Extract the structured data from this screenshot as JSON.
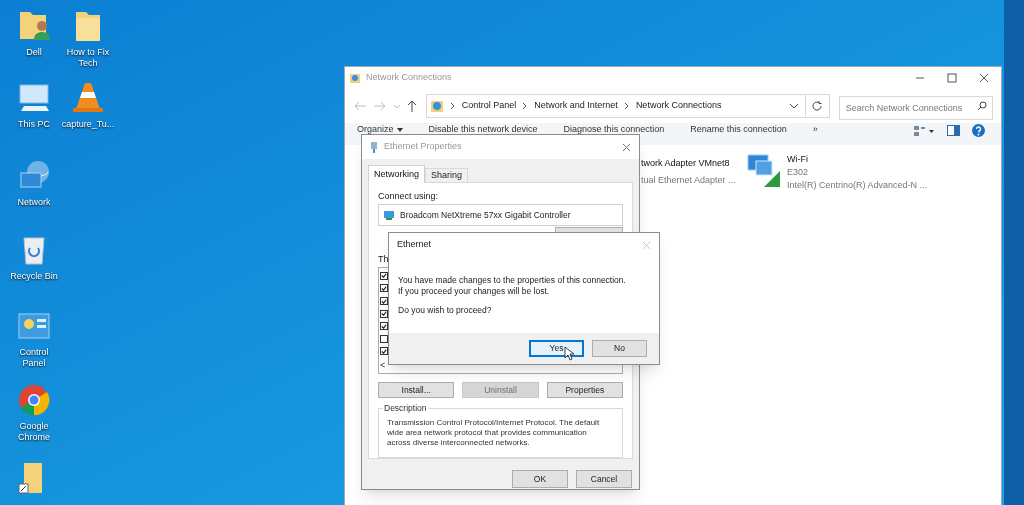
{
  "desktop_icons": [
    {
      "label": "Dell",
      "kind": "user-folder"
    },
    {
      "label": "How to Fix Tech",
      "kind": "folder"
    },
    {
      "label": "This PC",
      "kind": "pc"
    },
    {
      "label": "capture_Tu...",
      "kind": "cone"
    },
    {
      "label": "Network",
      "kind": "network"
    },
    {
      "label": "Recycle Bin",
      "kind": "bin"
    },
    {
      "label": "Control Panel",
      "kind": "panel"
    },
    {
      "label": "Google Chrome",
      "kind": "browser"
    },
    {
      "kind": "folder-shortcut"
    }
  ],
  "explorer": {
    "title": "Network Connections",
    "breadcrumb": [
      "Control Panel",
      "Network and Internet",
      "Network Connections"
    ],
    "search": {
      "placeholder": "Search Network Connections"
    },
    "toolbar": [
      "Organize",
      "Disable this network device",
      "Diagnose this connection",
      "Rename this connection",
      "»"
    ],
    "connections": [
      {
        "name": "twork Adapter VMnet8",
        "device": "tual Ethernet Adapter ...",
        "kind": "cut"
      },
      {
        "name": "Wi-Fi",
        "status": "E302",
        "device": "Intel(R) Centrino(R) Advanced-N ...",
        "kind": "wifi"
      }
    ]
  },
  "properties": {
    "title": "Ethernet Properties",
    "tabs": [
      {
        "label": "Networking",
        "selected": true
      },
      {
        "label": "Sharing",
        "selected": false
      }
    ],
    "connect_label": "Connect using:",
    "adapter": "Broadcom NetXtreme 57xx Gigabit Controller",
    "items_label": "Th",
    "items": [
      {
        "checked": true
      },
      {
        "checked": true
      },
      {
        "checked": true
      },
      {
        "checked": true
      },
      {
        "checked": true
      },
      {
        "checked": false
      },
      {
        "checked": true
      }
    ],
    "scroll_left": "<",
    "buttons": [
      {
        "label": "Install...",
        "disabled": false
      },
      {
        "label": "Uninstall",
        "disabled": true
      },
      {
        "label": "Properties",
        "disabled": false
      }
    ],
    "description_label": "Description",
    "description": "Transmission Control Protocol/Internet Protocol. The default wide area network protocol that provides communication across diverse interconnected networks.",
    "footer_buttons": [
      "OK",
      "Cancel"
    ]
  },
  "message": {
    "title": "Ethernet",
    "lines": [
      "You have made changes to the properties of this connection.",
      "If you proceed your changes will be lost."
    ],
    "question": "Do you wish to proceed?",
    "buttons": [
      {
        "label": "Yes",
        "selected": true
      },
      {
        "label": "No",
        "selected": false
      }
    ]
  }
}
